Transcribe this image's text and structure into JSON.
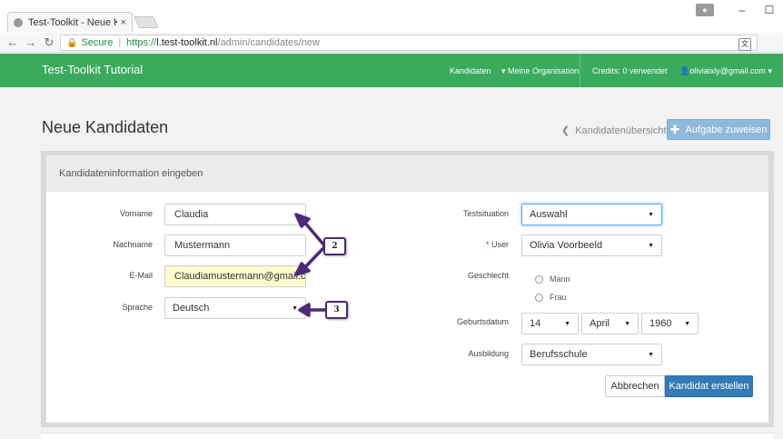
{
  "browser": {
    "tab_title": "Test-Toolkit - Neue Kandi",
    "tab_close": "×",
    "secure_label": "Secure",
    "url_scheme": "https://",
    "url_host": "l.test-toolkit.nl",
    "url_path": "/admin/candidates/new",
    "window_minimize": "–",
    "window_maximize": "☐"
  },
  "nav": {
    "brand": "Test-Toolkit Tutorial",
    "kandidaten": "Kandidaten",
    "organisation": "Meine Organisation",
    "credits": "Credits: 0 verwendet",
    "user": "oliviaixly@gmail.com"
  },
  "page": {
    "title": "Neue Kandidaten",
    "back_link": "Kandidatenübersicht",
    "assign_button": "Aufgabe zuweisen",
    "panel_title": "Kandidateninformation eingeben"
  },
  "form": {
    "vorname_label": "Vorname",
    "vorname_value": "Claudia",
    "nachname_label": "Nachname",
    "nachname_value": "Mustermann",
    "email_label": "E-Mail",
    "email_value": "Claudiamustermann@gmail.com",
    "sprache_label": "Sprache",
    "sprache_value": "Deutsch",
    "testsituation_label": "Testsituation",
    "testsituation_value": "Auswahl",
    "user_required": "*",
    "user_label": "User",
    "user_value": "Olivia Voorbeeld",
    "geschlecht_label": "Geschlecht",
    "gender_male": "Mann",
    "gender_female": "Frau",
    "geburtsdatum_label": "Geburtsdatum",
    "birth_day": "14",
    "birth_month": "April",
    "birth_year": "1960",
    "ausbildung_label": "Ausbildung",
    "ausbildung_value": "Berufsschule",
    "cancel_button": "Abbrechen",
    "create_button": "Kandidat erstellen"
  },
  "annotations": {
    "callout_2": "2",
    "callout_3": "3"
  },
  "colors": {
    "navbar": "#3aaa5c",
    "primary": "#337ab7",
    "callout_border": "#4b2a78"
  }
}
